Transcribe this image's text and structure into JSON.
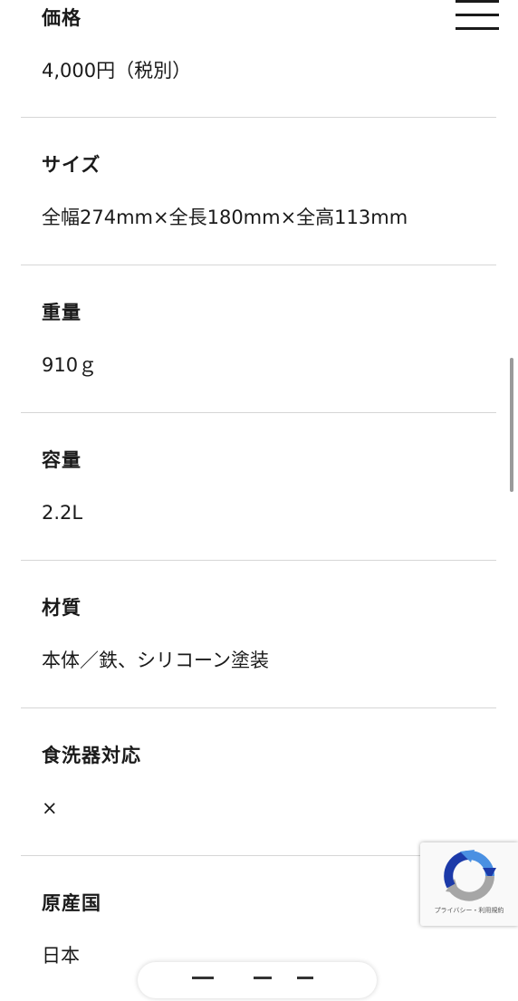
{
  "specs": [
    {
      "label": "価格",
      "value": "4,000円（税別）"
    },
    {
      "label": "サイズ",
      "value": "全幅274mm×全長180mm×全高113mm"
    },
    {
      "label": "重量",
      "value": "910ｇ"
    },
    {
      "label": "容量",
      "value": "2.2L"
    },
    {
      "label": "材質",
      "value": "本体／鉄、シリコーン塗装"
    },
    {
      "label": "食洗器対応",
      "value": "×"
    },
    {
      "label": "原産国",
      "value": "日本"
    }
  ],
  "menu": {
    "icon": "hamburger-icon"
  },
  "recaptcha": {
    "icon": "recaptcha-logo-icon",
    "links": "プライバシー・利用規約",
    "colors": {
      "blue": "#4a90e2",
      "gray": "#a6a6a6",
      "dark_blue": "#1c3aa9"
    }
  }
}
